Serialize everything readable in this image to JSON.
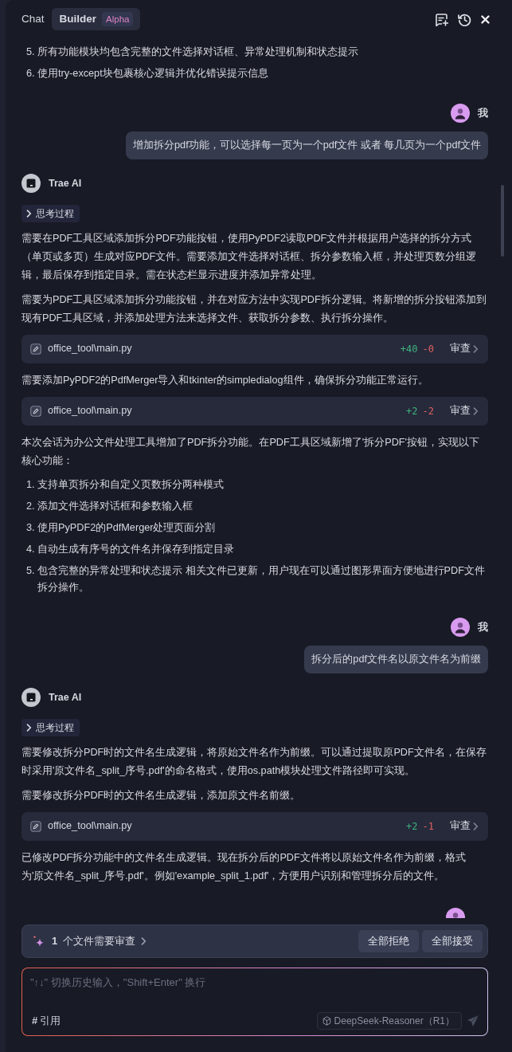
{
  "header": {
    "tabs": [
      {
        "label": "Chat",
        "selected": false
      },
      {
        "label": "Builder",
        "selected": true,
        "badge": "Alpha"
      }
    ]
  },
  "conversation": [
    {
      "kind": "assistant",
      "blocks": [
        {
          "kind": "list",
          "items": [
            {
              "number": "5.",
              "text": "所有功能模块均包含完整的文件选择对话框、异常处理机制和状态提示"
            },
            {
              "number": "6.",
              "text": "使用try-except块包裹核心逻辑并优化错误提示信息"
            }
          ]
        }
      ]
    },
    {
      "kind": "user",
      "author": "我",
      "text": "增加拆分pdf功能，可以选择每一页为一个pdf文件 或者 每几页为一个pdf文件"
    },
    {
      "kind": "assistant",
      "author": "Trae AI",
      "blocks": [
        {
          "kind": "thinking",
          "label": "思考过程",
          "expanded": false
        },
        {
          "kind": "paragraph",
          "text": "需要在PDF工具区域添加拆分PDF功能按钮，使用PyPDF2读取PDF文件并根据用户选择的拆分方式（单页或多页）生成对应PDF文件。需要添加文件选择对话框、拆分参数输入框，并处理页数分组逻辑，最后保存到指定目录。需在状态栏显示进度并添加异常处理。"
        },
        {
          "kind": "paragraph",
          "text": "需要为PDF工具区域添加拆分功能按钮，并在对应方法中实现PDF拆分逻辑。将新增的拆分按钮添加到现有PDF工具区域，并添加处理方法来选择文件、获取拆分参数、执行拆分操作。"
        },
        {
          "kind": "file",
          "path": "office_tool\\main.py",
          "added": "+40",
          "removed": "-0",
          "action": "审查"
        },
        {
          "kind": "paragraph",
          "text": "需要添加PyPDF2的PdfMerger导入和tkinter的simpledialog组件，确保拆分功能正常运行。"
        },
        {
          "kind": "file",
          "path": "office_tool\\main.py",
          "added": "+2",
          "removed": "-2",
          "action": "审查"
        },
        {
          "kind": "paragraph",
          "text": "本次会话为办公文件处理工具增加了PDF拆分功能。在PDF工具区域新增了'拆分PDF'按钮，实现以下核心功能："
        },
        {
          "kind": "list",
          "items": [
            {
              "number": "1.",
              "text": "支持单页拆分和自定义页数拆分两种模式"
            },
            {
              "number": "2.",
              "text": "添加文件选择对话框和参数输入框"
            },
            {
              "number": "3.",
              "text": "使用PyPDF2的PdfMerger处理页面分割"
            },
            {
              "number": "4.",
              "text": "自动生成有序号的文件名并保存到指定目录"
            },
            {
              "number": "5.",
              "text": "包含完整的异常处理和状态提示 相关文件已更新，用户现在可以通过图形界面方便地进行PDF文件拆分操作。"
            }
          ]
        }
      ]
    },
    {
      "kind": "user",
      "author": "我",
      "text": "拆分后的pdf文件名以原文件名为前缀"
    },
    {
      "kind": "assistant",
      "author": "Trae AI",
      "blocks": [
        {
          "kind": "thinking",
          "label": "思考过程",
          "expanded": false
        },
        {
          "kind": "paragraph",
          "text": "需要修改拆分PDF时的文件名生成逻辑，将原始文件名作为前缀。可以通过提取原PDF文件名，在保存时采用'原文件名_split_序号.pdf'的命名格式，使用os.path模块处理文件路径即可实现。"
        },
        {
          "kind": "paragraph",
          "text": "需要修改拆分PDF时的文件名生成逻辑，添加原文件名前缀。"
        },
        {
          "kind": "file",
          "path": "office_tool\\main.py",
          "added": "+2",
          "removed": "-1",
          "action": "审查"
        },
        {
          "kind": "paragraph",
          "text": "已修改PDF拆分功能中的文件名生成逻辑。现在拆分后的PDF文件将以原始文件名作为前缀，格式为'原文件名_split_序号.pdf'。例如'example_split_1.pdf'，方便用户识别和管理拆分后的文件。"
        }
      ]
    },
    {
      "kind": "user"
    }
  ],
  "review_bar": {
    "count": "1",
    "label": "个文件需要审查",
    "buttons": [
      "全部拒绝",
      "全部接受"
    ]
  },
  "composer": {
    "placeholder": "\"↑↓\" 切换历史输入，\"Shift+Enter\" 换行",
    "reference": {
      "symbol": "#",
      "label": "引用"
    },
    "model": "DeepSeek-Reasoner（R1）"
  }
}
